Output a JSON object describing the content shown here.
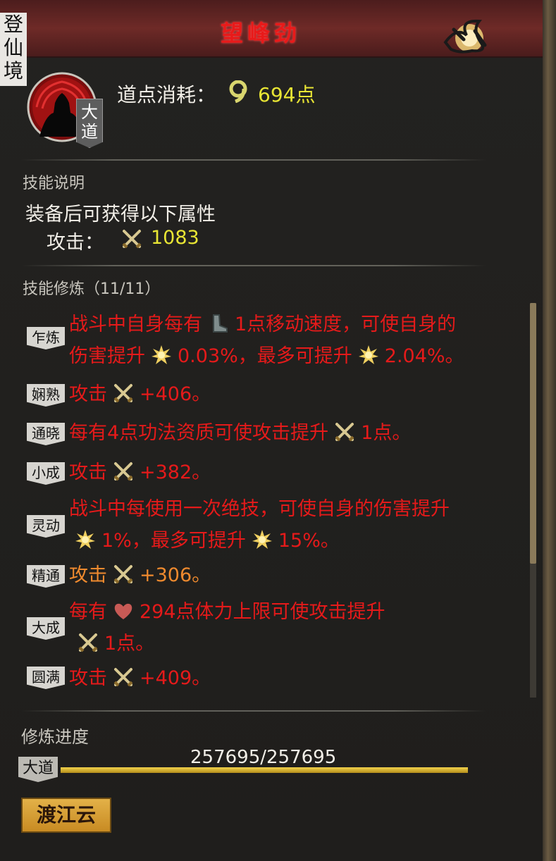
{
  "corner_badge": "登仙境",
  "title": "望峰劲",
  "skill_tag": "大道",
  "cost": {
    "label": "道点消耗：",
    "value": "694点"
  },
  "description": {
    "section_title": "技能说明",
    "text": "装备后可获得以下属性",
    "attr_label": "攻击：",
    "attr_value": "1083"
  },
  "cultivation": {
    "section_title": "技能修炼（11/11）",
    "rows": [
      {
        "tag": "乍炼",
        "color": "red",
        "lines": [
          [
            {
              "t": "战斗中自身每有"
            },
            {
              "i": "boot-icon"
            },
            {
              "t": "1点移动速度，可使自身的"
            }
          ],
          [
            {
              "t": "伤害提升"
            },
            {
              "i": "burst-icon"
            },
            {
              "t": "0.03%，最多可提升"
            },
            {
              "i": "burst-icon"
            },
            {
              "t": "2.04%。"
            }
          ]
        ]
      },
      {
        "tag": "娴熟",
        "color": "red",
        "lines": [
          [
            {
              "t": "攻击"
            },
            {
              "i": "sword-icon"
            },
            {
              "t": "+406。"
            }
          ]
        ]
      },
      {
        "tag": "通晓",
        "color": "red",
        "lines": [
          [
            {
              "t": "每有4点功法资质可使攻击提升"
            },
            {
              "i": "sword-icon"
            },
            {
              "t": "1点。"
            }
          ]
        ]
      },
      {
        "tag": "小成",
        "color": "red",
        "lines": [
          [
            {
              "t": "攻击"
            },
            {
              "i": "sword-icon"
            },
            {
              "t": "+382。"
            }
          ]
        ]
      },
      {
        "tag": "灵动",
        "color": "red",
        "lines": [
          [
            {
              "t": "战斗中每使用一次绝技，可使自身的伤害提升"
            }
          ],
          [
            {
              "i": "burst-icon"
            },
            {
              "t": "1%，最多可提升"
            },
            {
              "i": "burst-icon"
            },
            {
              "t": "15%。"
            }
          ]
        ]
      },
      {
        "tag": "精通",
        "color": "orange",
        "lines": [
          [
            {
              "t": "攻击"
            },
            {
              "i": "sword-icon"
            },
            {
              "t": "+306。"
            }
          ]
        ]
      },
      {
        "tag": "大成",
        "color": "red",
        "lines": [
          [
            {
              "t": "每有"
            },
            {
              "i": "heart-icon"
            },
            {
              "t": "294点体力上限可使攻击提升"
            }
          ],
          [
            {
              "i": "sword-icon"
            },
            {
              "t": "1点。"
            }
          ]
        ]
      },
      {
        "tag": "圆满",
        "color": "red",
        "lines": [
          [
            {
              "t": "攻击"
            },
            {
              "i": "sword-icon"
            },
            {
              "t": "+409。"
            }
          ]
        ]
      }
    ]
  },
  "progress": {
    "label": "修炼进度",
    "tag": "大道",
    "text": "257695/257695",
    "fraction": 1.0
  },
  "button_label": "渡江云",
  "colors": {
    "red": "#e51a1a",
    "orange": "#ef8a2e",
    "yellow": "#e8e534"
  }
}
